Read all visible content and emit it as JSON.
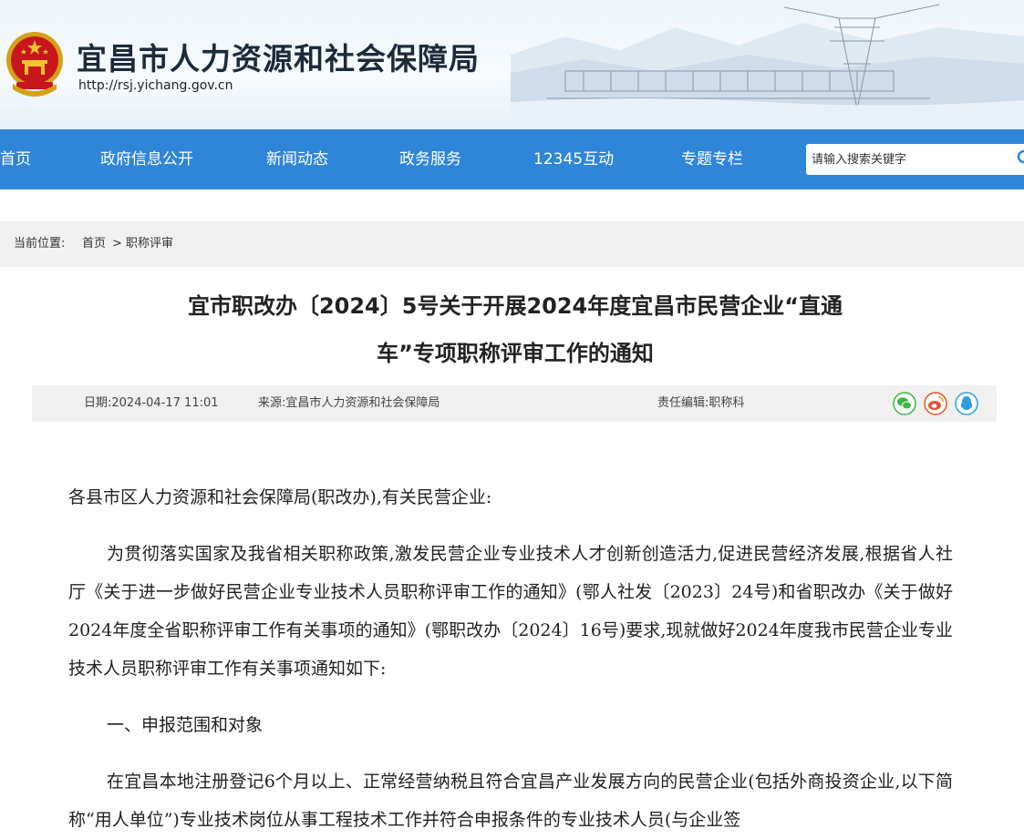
{
  "header": {
    "site_title": "宜昌市人力资源和社会保障局",
    "site_url": "http://rsj.yichang.gov.cn"
  },
  "nav": {
    "items": [
      "首页",
      "政府信息公开",
      "新闻动态",
      "政务服务",
      "12345互动",
      "专题专栏"
    ],
    "search_placeholder": "请输入搜索关键字"
  },
  "breadcrumb": {
    "prefix": "当前位置:",
    "home": "首页",
    "sep": ">",
    "current": "职称评审"
  },
  "article": {
    "title_line1": "宜市职改办〔2024〕5号关于开展2024年度宜昌市民营企业“直通",
    "title_line2": "车”专项职称评审工作的通知",
    "date": "日期:2024-04-17 11:01",
    "source": "来源:宜昌市人力资源和社会保障局",
    "editor": "责任编辑:职称科",
    "paragraphs": [
      "各县市区人力资源和社会保障局(职改办),有关民营企业:",
      "为贯彻落实国家及我省相关职称政策,激发民营企业专业技术人才创新创造活力,促进民营经济发展,根据省人社厅《关于进一步做好民营企业专业技术人员职称评审工作的通知》(鄂人社发〔2023〕24号)和省职改办《关于做好2024年度全省职称评审工作有关事项的通知》(鄂职改办〔2024〕16号)要求,现就做好2024年度我市民营企业专业技术人员职称评审工作有关事项通知如下:",
      "一、申报范围和对象",
      "在宜昌本地注册登记6个月以上、正常经营纳税且符合宜昌产业发展方向的民营企业(包括外商投资企业,以下简称“用人单位”)专业技术岗位从事工程技术工作并符合申报条件的专业技术人员(与企业签"
    ]
  },
  "colors": {
    "nav_bg": "#2f86d9",
    "wechat": "#3bb54a",
    "weibo": "#e6512a",
    "qq": "#2f9ce0"
  }
}
